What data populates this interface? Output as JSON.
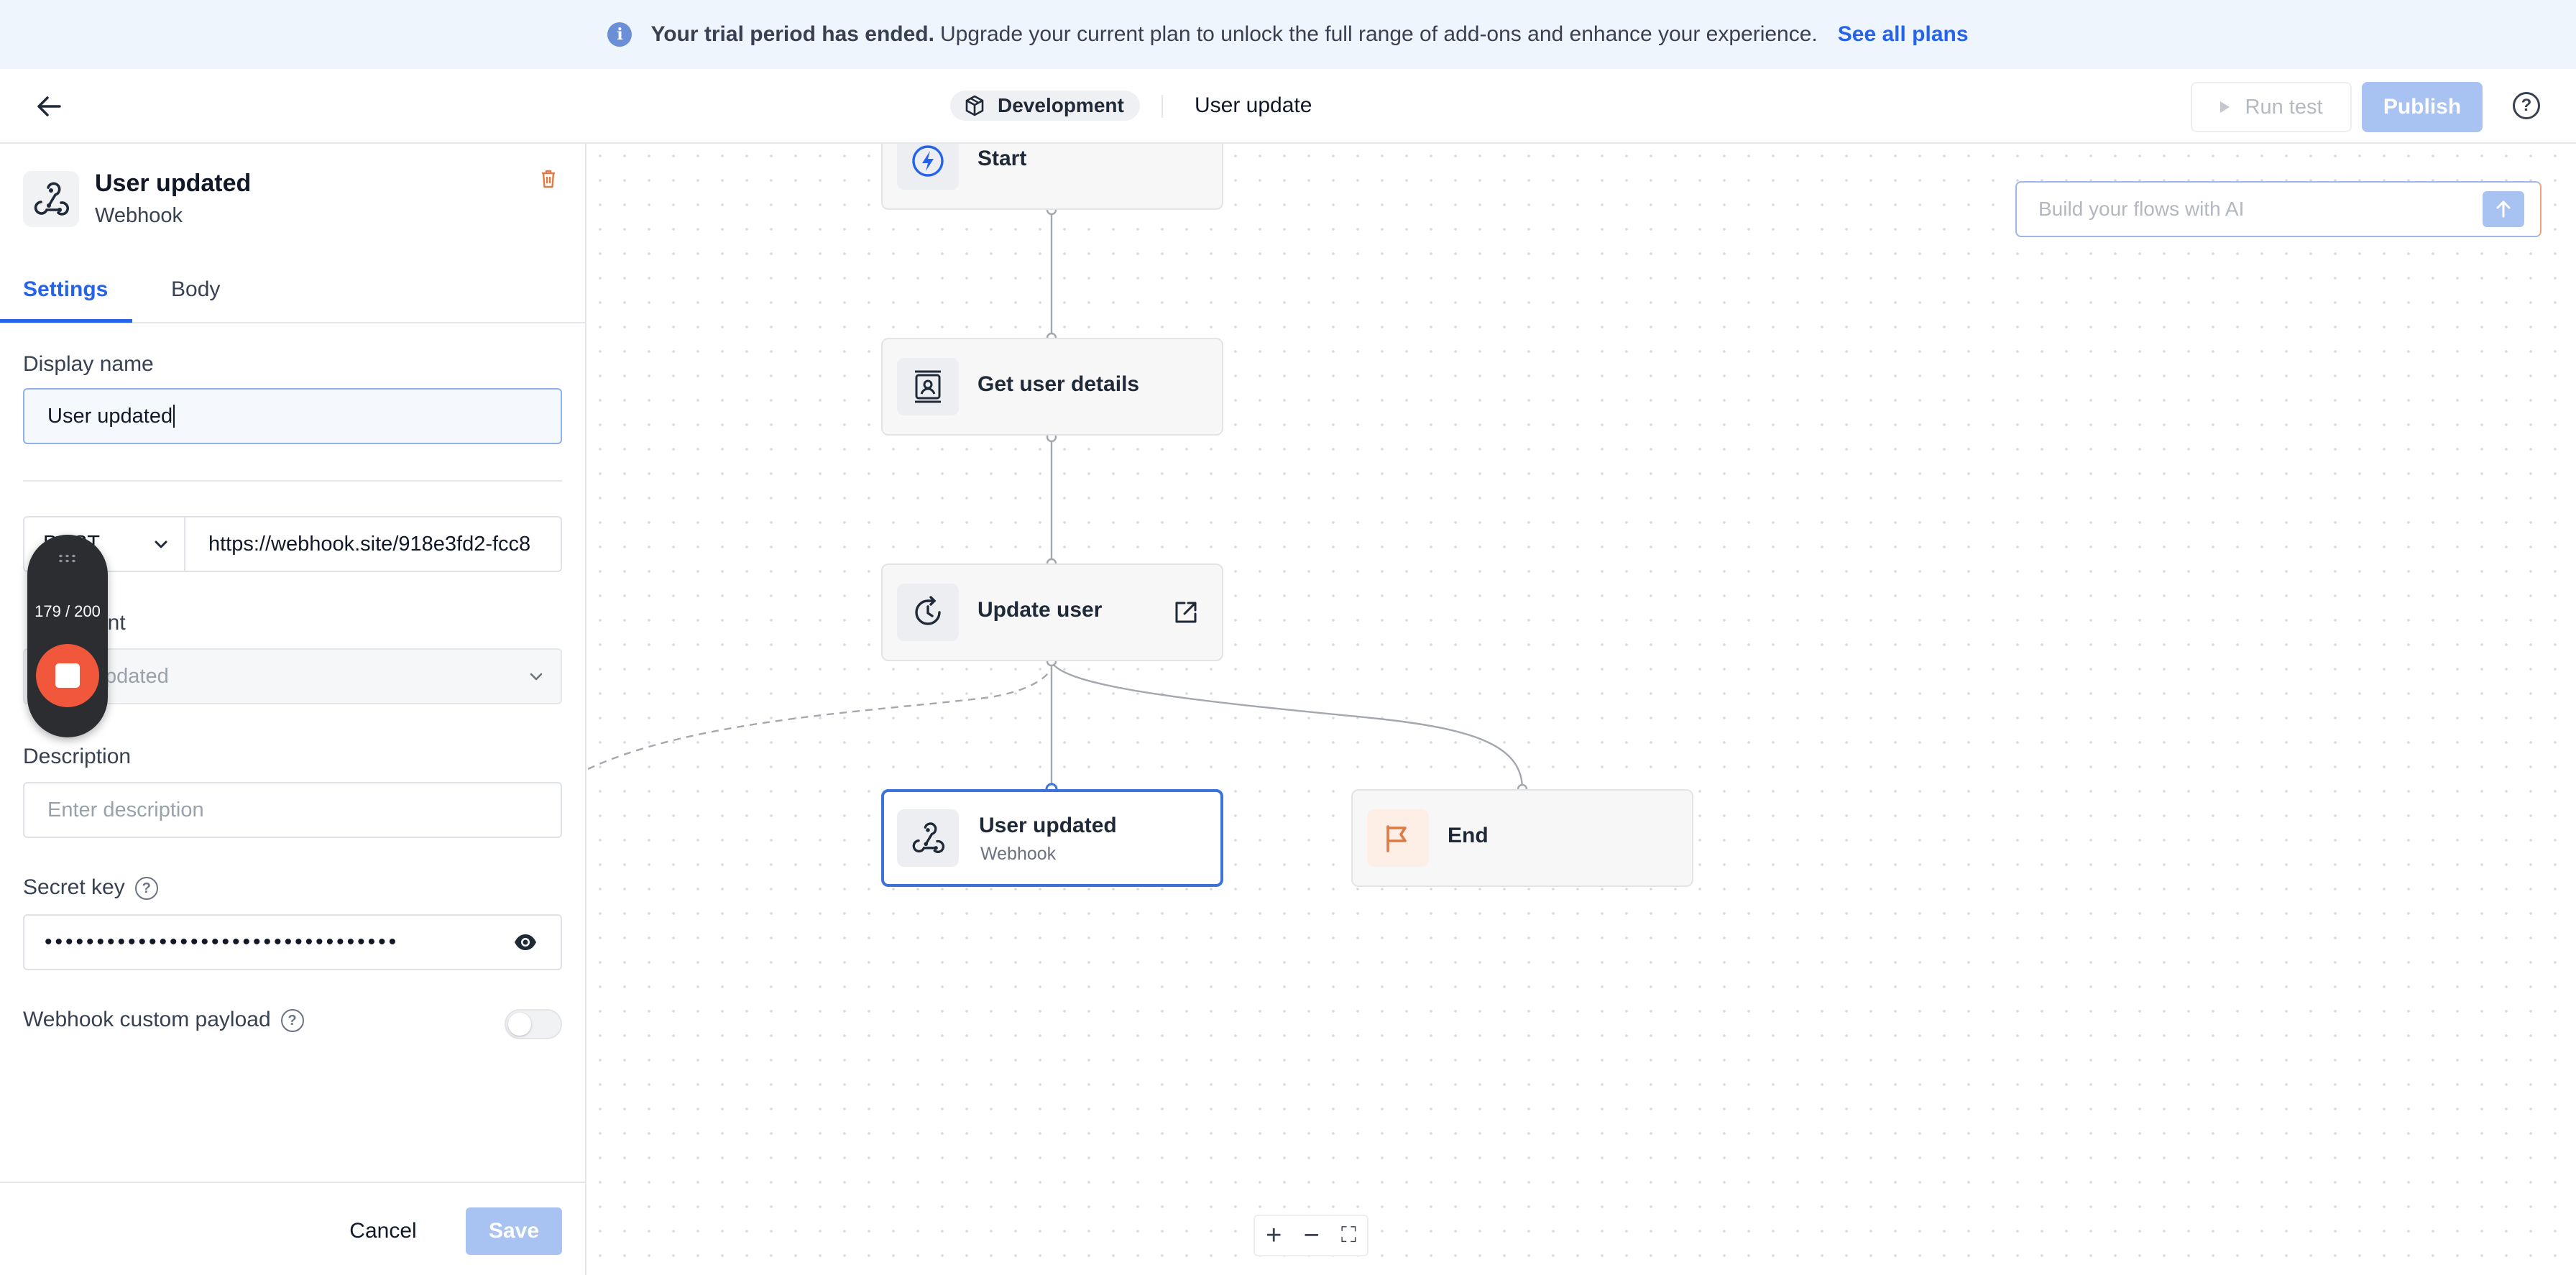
{
  "banner": {
    "bold_text": "Your trial period has ended.",
    "text": "Upgrade your current plan to unlock the full range of add-ons and enhance your experience.",
    "link": "See all plans"
  },
  "header": {
    "environment": "Development",
    "flow_name": "User update",
    "run_test_label": "Run test",
    "publish_label": "Publish"
  },
  "panel": {
    "title": "User updated",
    "subtitle": "Webhook",
    "tabs": [
      {
        "label": "Settings",
        "active": true
      },
      {
        "label": "Body",
        "active": false
      }
    ],
    "display_name_label": "Display name",
    "display_name_value": "User updated",
    "method_value": "POST",
    "url_value": "https://webhook.site/918e3fd2-fcc8",
    "event_label": "vent",
    "event_value": "pdated",
    "description_label": "Description",
    "description_placeholder": "Enter description",
    "secret_key_label": "Secret key",
    "secret_key_value": "••••••••••••••••••••••••••••••••••",
    "custom_payload_label": "Webhook custom payload",
    "custom_payload_enabled": false,
    "cancel_label": "Cancel",
    "save_label": "Save"
  },
  "recorder": {
    "count": "179 / 200"
  },
  "canvas": {
    "ai_placeholder": "Build your flows with AI",
    "nodes": [
      {
        "title": "Start",
        "icon": "lightning-icon"
      },
      {
        "title": "Get user details",
        "icon": "contact-card-icon"
      },
      {
        "title": "Update user",
        "icon": "refresh-clock-icon"
      },
      {
        "title": "User updated",
        "subtitle": "Webhook",
        "icon": "webhook-icon",
        "selected": true
      },
      {
        "title": "End",
        "icon": "flag-icon"
      }
    ],
    "zoom_controls": [
      "+",
      "−",
      "⛶"
    ]
  },
  "colors": {
    "accent": "#2563eb",
    "primary_disabled": "#a8c3f2",
    "selected_border": "#3b73d8",
    "end_icon": "#e07a45",
    "start_icon": "#2563eb"
  }
}
